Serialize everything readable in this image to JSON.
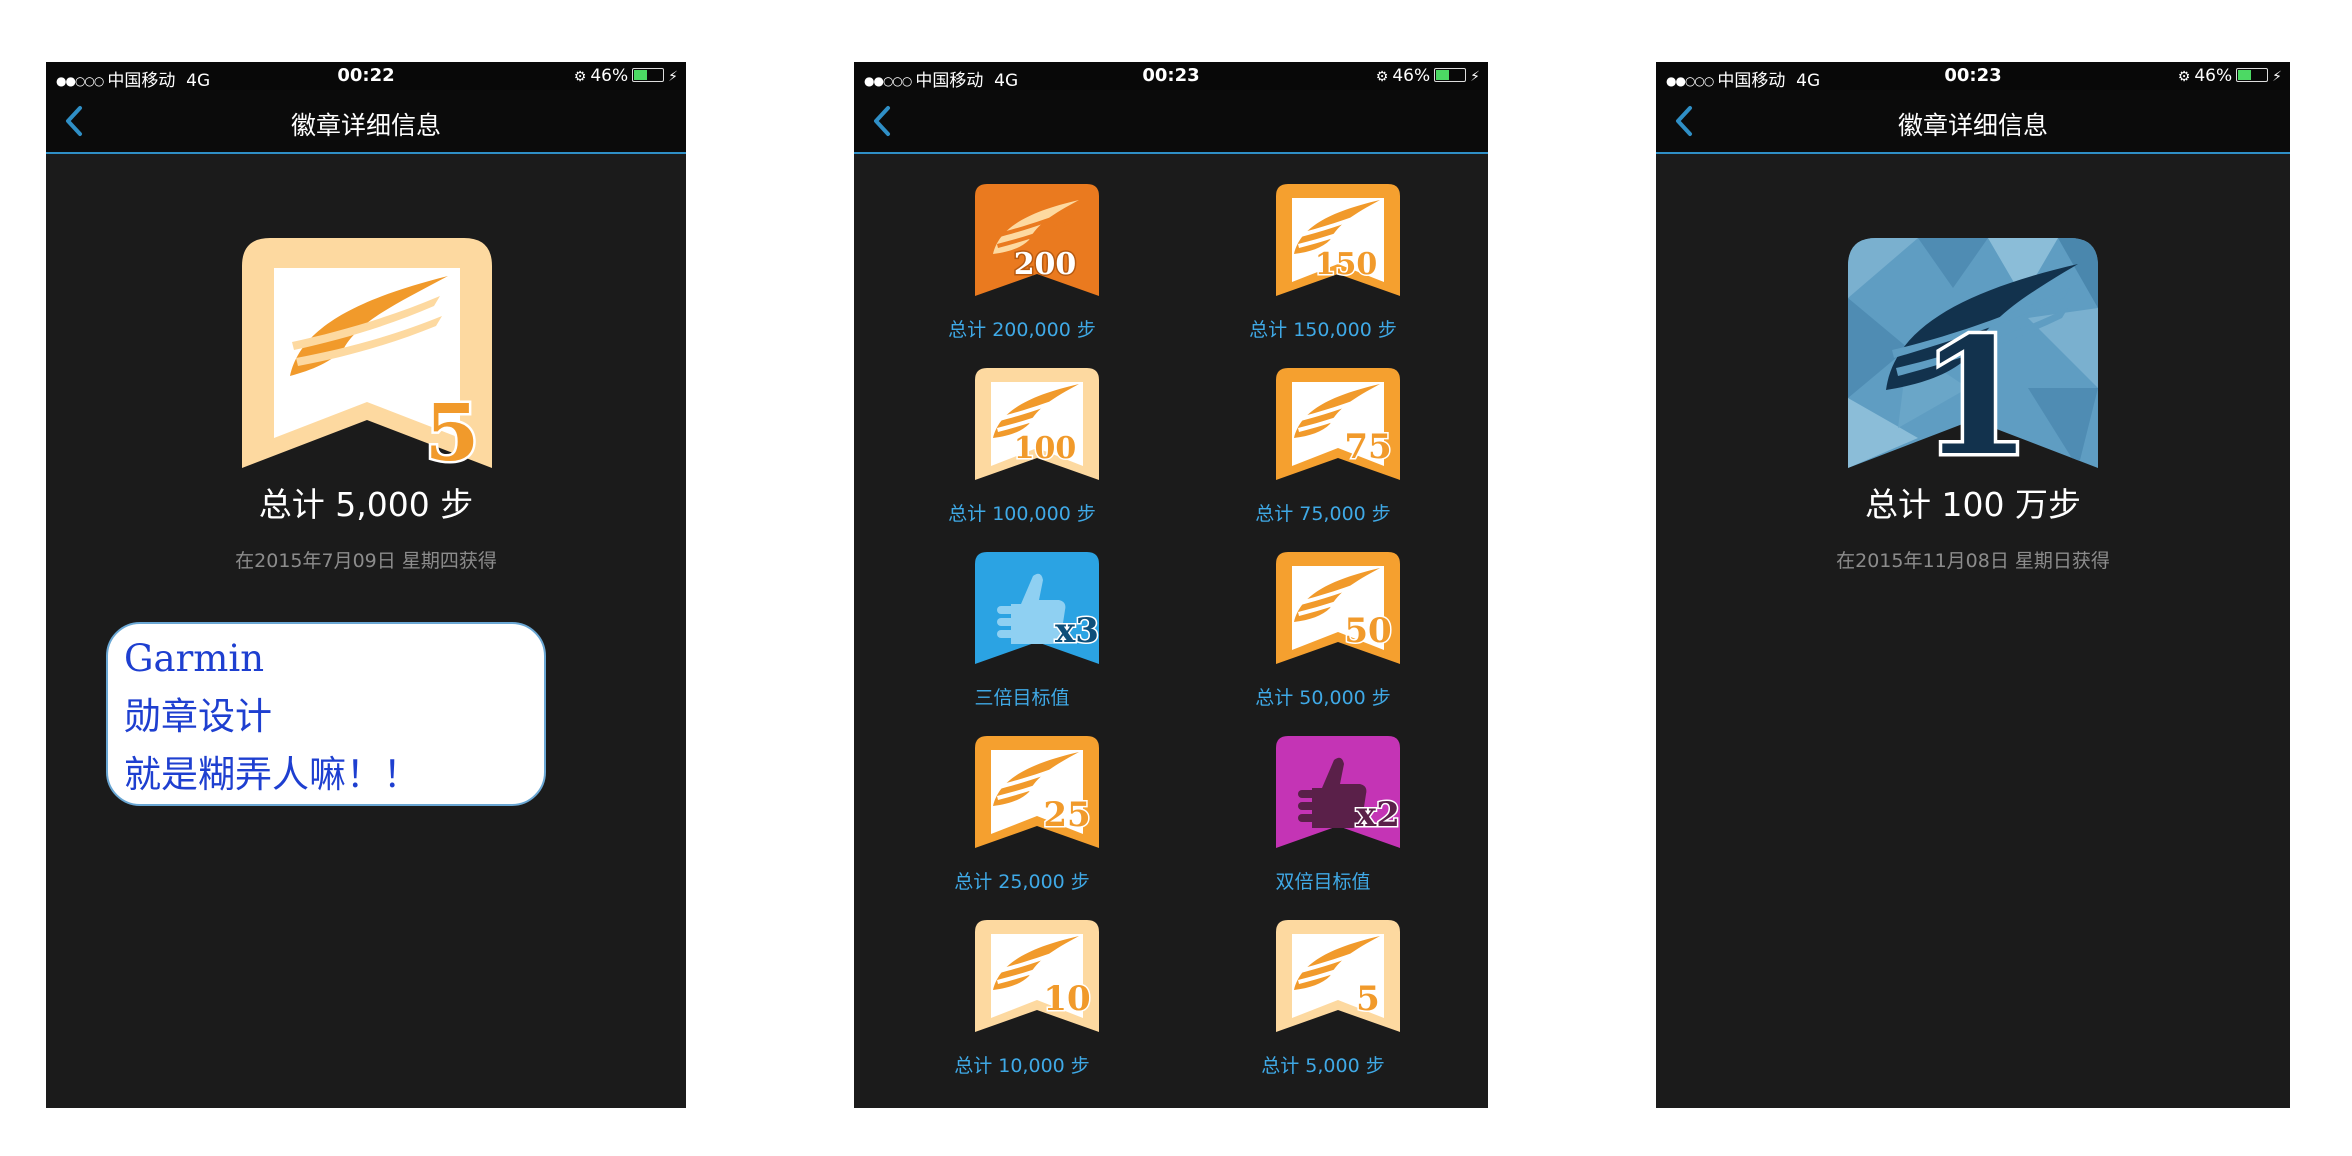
{
  "screens": [
    {
      "status": {
        "signal": "●●○○○",
        "carrier": "中国移动",
        "network": "4G",
        "time": "00:22",
        "battery": "46%"
      },
      "nav_title": "徽章详细信息",
      "badge": {
        "number": "5",
        "style": "light-orange",
        "title": "总计 5,000 步",
        "date": "在2015年7月09日 星期四获得"
      },
      "note": {
        "line1": "Garmin",
        "line2": "勋章设计",
        "line3": "就是糊弄人嘛！！"
      }
    },
    {
      "status": {
        "signal": "●●○○○",
        "carrier": "中国移动",
        "network": "4G",
        "time": "00:23",
        "battery": "46%"
      },
      "nav_title": "",
      "badges": [
        {
          "label": "总计 200,000 步",
          "number": "200",
          "style": "deep-orange"
        },
        {
          "label": "总计 150,000 步",
          "number": "150",
          "style": "amber"
        },
        {
          "label": "总计 100,000 步",
          "number": "100",
          "style": "peach"
        },
        {
          "label": "总计 75,000 步",
          "number": "75",
          "style": "amber"
        },
        {
          "label": "三倍目标值",
          "number": "x3",
          "style": "blue-thumb"
        },
        {
          "label": "总计 50,000 步",
          "number": "50",
          "style": "amber"
        },
        {
          "label": "总计 25,000 步",
          "number": "25",
          "style": "amber"
        },
        {
          "label": "双倍目标值",
          "number": "x2",
          "style": "purple-thumb"
        },
        {
          "label": "总计 10,000 步",
          "number": "10",
          "style": "peach"
        },
        {
          "label": "总计 5,000 步",
          "number": "5",
          "style": "peach"
        }
      ]
    },
    {
      "status": {
        "signal": "●●○○○",
        "carrier": "中国移动",
        "network": "4G",
        "time": "00:23",
        "battery": "46%"
      },
      "nav_title": "徽章详细信息",
      "badge": {
        "number": "1",
        "style": "blue-mosaic",
        "title": "总计 100 万步",
        "date": "在2015年11月08日 星期日获得"
      }
    }
  ],
  "colors": {
    "accent": "#2f8fc6",
    "label_blue": "#3fa9e6",
    "background": "#1b1b1b",
    "orange": "#f19a2b",
    "peach": "#fdd9a0"
  }
}
